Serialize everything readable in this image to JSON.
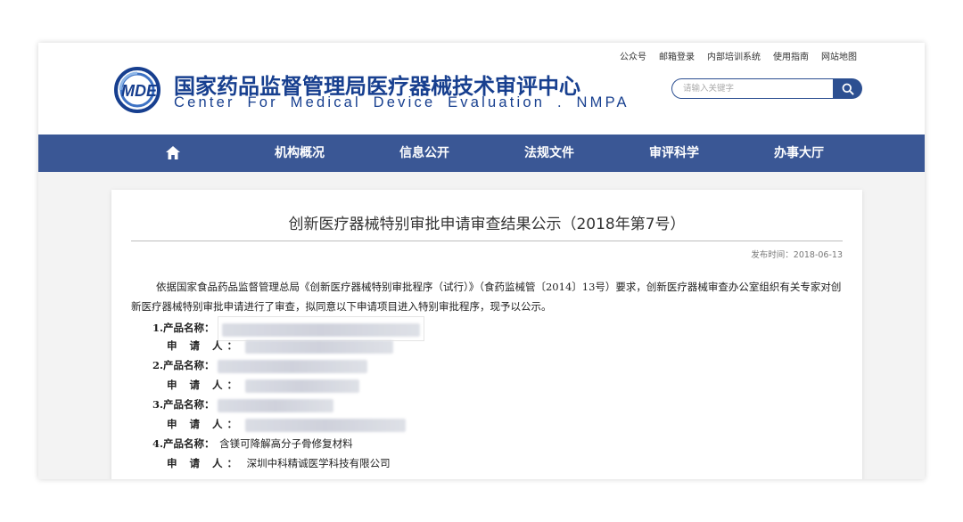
{
  "header": {
    "logo_text": "MDE",
    "title_cn": "国家药品监督管理局医疗器械技术审评中心",
    "title_en": "Center For Medical Device Evaluation . NMPA",
    "top_links": [
      "公众号",
      "邮箱登录",
      "内部培训系统",
      "使用指南",
      "网站地图"
    ],
    "search_placeholder": "请输入关键字"
  },
  "nav": {
    "items": [
      "机构概况",
      "信息公开",
      "法规文件",
      "审评科学",
      "办事大厅"
    ]
  },
  "article": {
    "title": "创新医疗器械特别审批申请审查结果公示（2018年第7号）",
    "publish_label": "发布时间：2018-06-13",
    "intro": "依据国家食品药品监督管理总局《创新医疗器械特别审批程序（试行）》（食药监械管〔2014〕13号）要求，创新医疗器械审查办公室组织有关专家对创新医疗器械特别审批申请进行了审查，拟同意以下申请项目进入特别审批程序，现予以公示。",
    "product_label_suffix": "产品名称：",
    "applicant_label": "申 请 人：",
    "entries": [
      {
        "num": "1.",
        "product": "",
        "applicant": ""
      },
      {
        "num": "2.",
        "product": "",
        "applicant": ""
      },
      {
        "num": "3.",
        "product": "",
        "applicant": ""
      },
      {
        "num": "4.",
        "product": "含镁可降解高分子骨修复材料",
        "applicant": "深圳中科精诚医学科技有限公司"
      }
    ]
  },
  "colors": {
    "brand_blue": "#173f8f",
    "nav_bg": "#3a5795"
  }
}
